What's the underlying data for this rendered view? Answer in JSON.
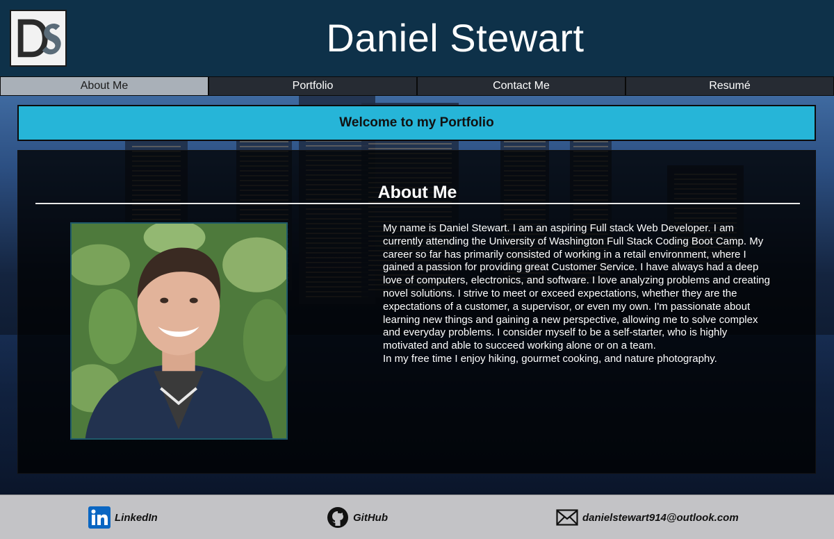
{
  "header": {
    "title": "Daniel Stewart",
    "logo_icon": "ds-monogram-logo"
  },
  "nav": {
    "items": [
      {
        "label": "About Me",
        "active": true
      },
      {
        "label": "Portfolio",
        "active": false
      },
      {
        "label": "Contact Me",
        "active": false
      },
      {
        "label": "Resumé",
        "active": false
      }
    ]
  },
  "welcome": {
    "text": "Welcome to my Portfolio"
  },
  "about": {
    "title": "About Me",
    "photo_icon": "profile-photo",
    "bio_paragraphs": [
      "My name is Daniel Stewart. I am an aspiring Full stack Web Developer. I am currently attending the University of Washington Full Stack Coding Boot Camp. My career so far has primarily consisted of working in a retail environment, where I gained a passion for providing great Customer Service. I have always had a deep love of computers, electronics, and software. I love analyzing problems and creating novel solutions. I strive to meet or exceed expectations, whether they are the expectations of a customer, a supervisor, or even my own. I'm passionate about learning new things and gaining a new perspective, allowing me to solve complex and everyday problems. I consider myself to be a self-starter, who is highly motivated and able to succeed working alone or on a team.",
      "In my free time I enjoy hiking, gourmet cooking, and nature photography."
    ]
  },
  "footer": {
    "linkedin": {
      "label": "LinkedIn",
      "icon": "linkedin-icon"
    },
    "github": {
      "label": "GitHub",
      "icon": "github-icon"
    },
    "email": {
      "label": "danielstewart914@outlook.com",
      "icon": "mail-icon"
    }
  },
  "colors": {
    "header_bg": "#0e3149",
    "nav_active": "#a9b0b8",
    "nav_inactive": "#262b33",
    "welcome_bg": "#26b5d8",
    "footer_bg": "#c3c3c6"
  }
}
